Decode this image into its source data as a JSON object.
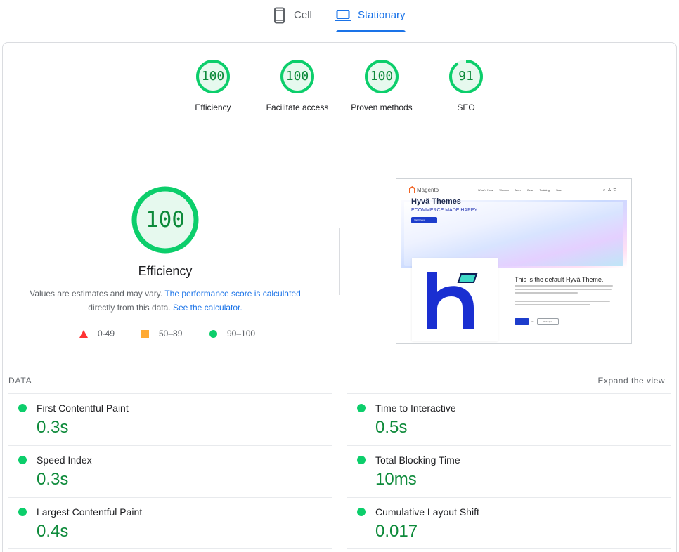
{
  "tabs": [
    {
      "label": "Cell",
      "icon": "phone-icon",
      "active": false
    },
    {
      "label": "Stationary",
      "icon": "laptop-icon",
      "active": true
    }
  ],
  "gauges": [
    {
      "score": "100",
      "label": "Efficiency",
      "fraction": 1.0
    },
    {
      "score": "100",
      "label": "Facilitate access",
      "fraction": 1.0
    },
    {
      "score": "100",
      "label": "Proven methods",
      "fraction": 1.0
    },
    {
      "score": "91",
      "label": "SEO",
      "fraction": 0.91
    }
  ],
  "summary": {
    "score": "100",
    "fraction": 1.0,
    "title": "Efficiency",
    "desc_prefix": "Values are estimates and may vary. ",
    "desc_link1": "The performance score is calculated",
    "desc_mid": "directly from this data. ",
    "desc_link2": "See the calculator.",
    "legend": [
      {
        "range": "0-49",
        "shape": "triangle",
        "color": "#ff3333"
      },
      {
        "range": "50–89",
        "shape": "square",
        "color": "#ffaa33"
      },
      {
        "range": "90–100",
        "shape": "circle",
        "color": "#0cce6b"
      }
    ]
  },
  "preview": {
    "logo": "Magento",
    "menu": [
      "What's New",
      "Women",
      "Men",
      "Gear",
      "Training",
      "Sale"
    ],
    "hero_title": "Hyvä Themes",
    "hero_subtitle": "ECOMMERCE MADE HAPPY.",
    "hero_button": "Visit hyva.io",
    "right_title": "This is the default Hyvä Theme.",
    "button_or": "or",
    "button_secondary": "Visit Hyvä"
  },
  "metrics": {
    "header": "DATA",
    "expand": "Expand the view",
    "left": [
      {
        "name": "First Contentful Paint",
        "value": "0.3s"
      },
      {
        "name": "Speed Index",
        "value": "0.3s"
      },
      {
        "name": "Largest Contentful Paint",
        "value": "0.4s"
      }
    ],
    "right": [
      {
        "name": "Time to Interactive",
        "value": "0.5s"
      },
      {
        "name": "Total Blocking Time",
        "value": "10ms"
      },
      {
        "name": "Cumulative Layout Shift",
        "value": "0.017"
      }
    ]
  },
  "colors": {
    "pass": "#0cce6b",
    "pass_text": "#0d8a3a",
    "accent": "#1a73e8"
  }
}
